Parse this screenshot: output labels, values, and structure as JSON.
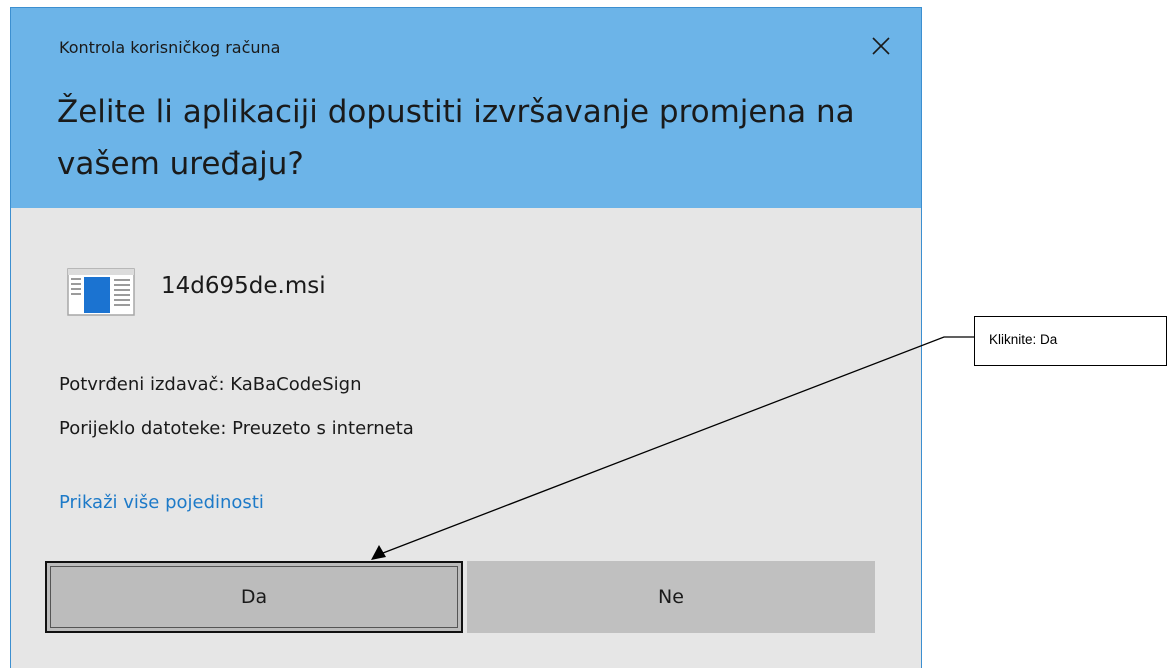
{
  "dialog": {
    "window_title": "Kontrola korisničkog računa",
    "headline": "Želite li aplikaciji dopustiti izvršavanje promjena na vašem uređaju?",
    "file_name": "14d695de.msi",
    "publisher_line": "Potvrđeni izdavač: KaBaCodeSign",
    "origin_line": "Porijeklo datoteke: Preuzeto s interneta",
    "details_link": "Prikaži više pojedinosti",
    "yes_button": "Da",
    "no_button": "Ne",
    "close_icon": "close-icon",
    "app_icon": "installer-app-icon"
  },
  "annotation": {
    "callout_text": "Kliknite: Da"
  },
  "colors": {
    "header_blue": "#6cb4e8",
    "dialog_background": "#e6e6e6",
    "link_blue": "#1d7ac8",
    "button_gray": "#c0c0c0"
  }
}
